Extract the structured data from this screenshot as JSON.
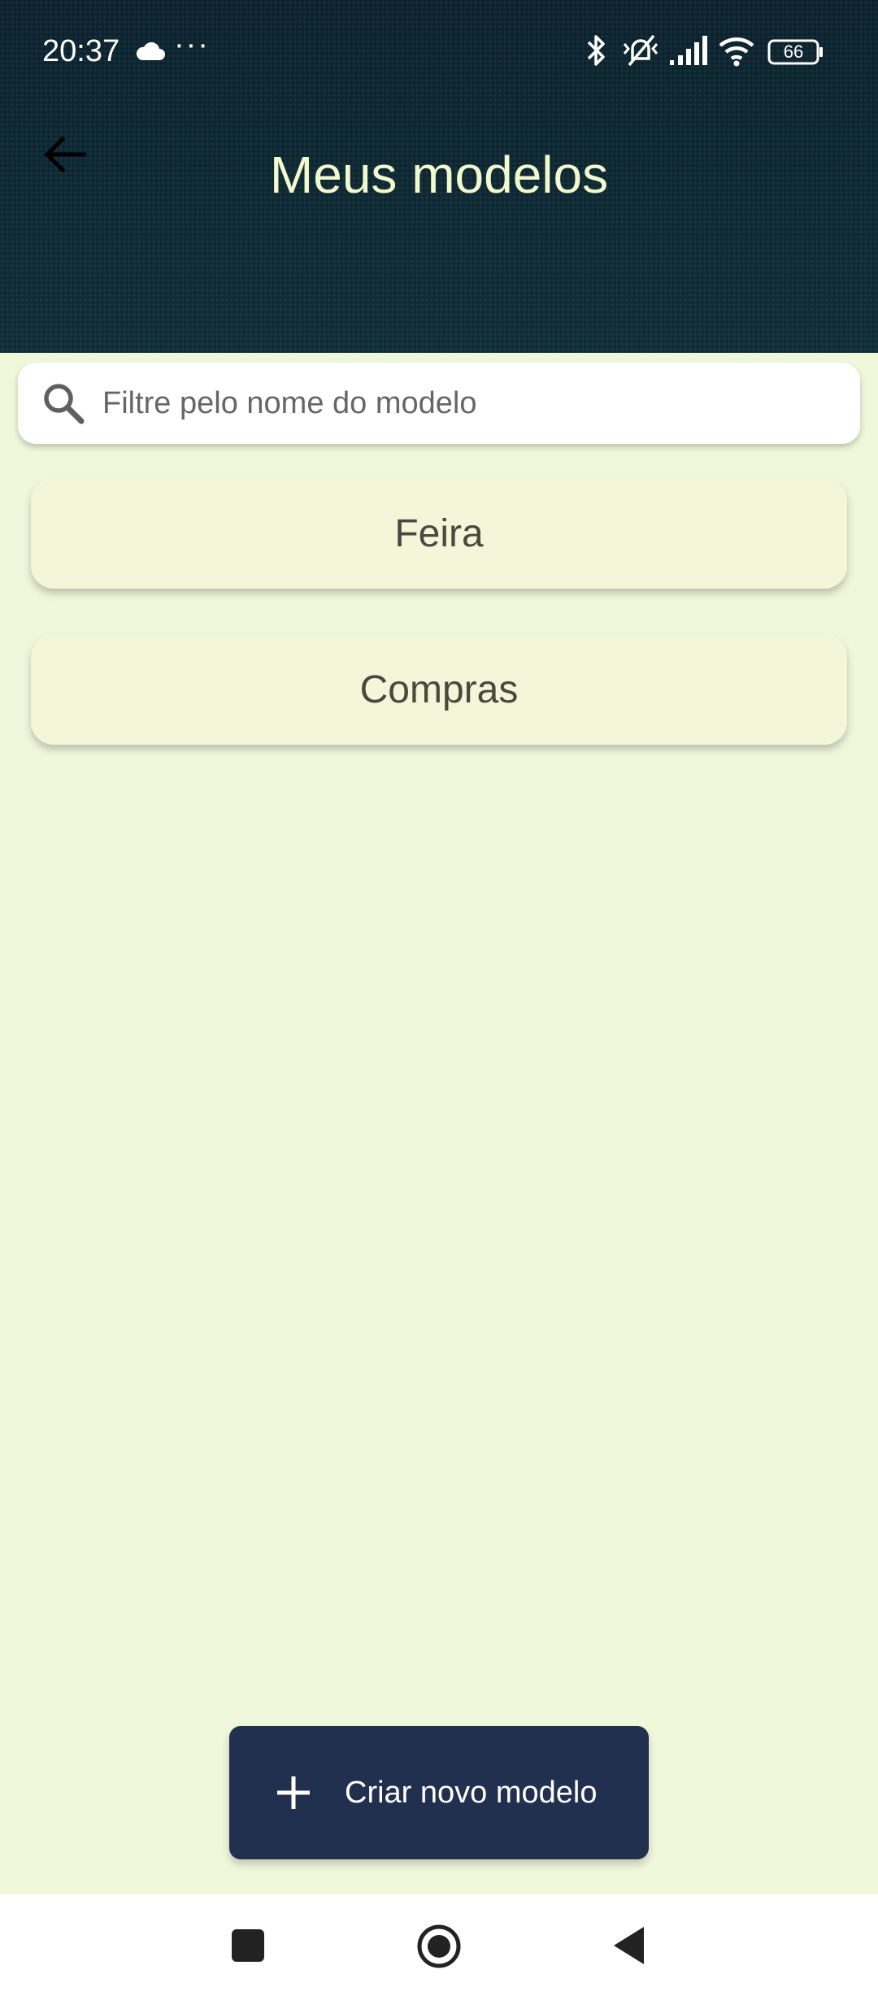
{
  "status_bar": {
    "time": "20:37",
    "more": "···",
    "battery": "66",
    "icons": [
      "cloud-icon",
      "bluetooth-icon",
      "vibrate-off-icon",
      "signal-icon",
      "wifi-icon",
      "battery-icon"
    ]
  },
  "header": {
    "title": "Meus modelos",
    "back_icon": "arrow-left-icon"
  },
  "search": {
    "placeholder": "Filtre pelo nome do modelo",
    "value": ""
  },
  "models": [
    {
      "label": "Feira"
    },
    {
      "label": "Compras"
    }
  ],
  "create_button": {
    "label": "Criar novo modelo",
    "icon": "plus-icon"
  },
  "nav_bar": {
    "icons": [
      "recents-square-icon",
      "home-circle-icon",
      "back-triangle-icon"
    ]
  },
  "colors": {
    "header_bg": "#102a33",
    "title": "#f2f9cf",
    "page_bg": "#f0f8dc",
    "card_bg": "#f4f6da",
    "button_bg": "#22304f"
  }
}
